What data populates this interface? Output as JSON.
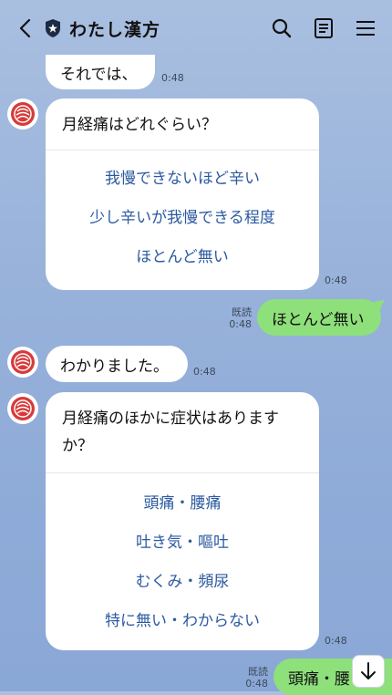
{
  "header": {
    "title": "わたし漢方",
    "back_icon": "chevron-left-icon",
    "shield_icon": "shield-icon",
    "search_icon": "search-icon",
    "notes_icon": "notes-icon",
    "menu_icon": "menu-icon"
  },
  "messages": {
    "m1": {
      "text": "それでは、",
      "time": "0:48"
    },
    "m2": {
      "question": "月経痛はどれぐらい？",
      "options": [
        "我慢できないほど辛い",
        "少し辛いが我慢できる程度",
        "ほとんど無い"
      ],
      "time": "0:48"
    },
    "m3": {
      "text": "ほとんど無い",
      "read": "既読",
      "time": "0:48"
    },
    "m4": {
      "text": "わかりました。",
      "time": "0:48"
    },
    "m5": {
      "question": "月経痛のほかに症状はありますか？",
      "options": [
        "頭痛・腰痛",
        "吐き気・嘔吐",
        "むくみ・頻尿",
        "特に無い・わからない"
      ],
      "time": "0:48"
    },
    "m6": {
      "text": "頭痛・腰",
      "read": "既読",
      "time": "0:48"
    }
  },
  "colors": {
    "accent_link": "#2c5aa0",
    "user_bubble": "#8ee07a",
    "avatar_red": "#d83a3a"
  }
}
